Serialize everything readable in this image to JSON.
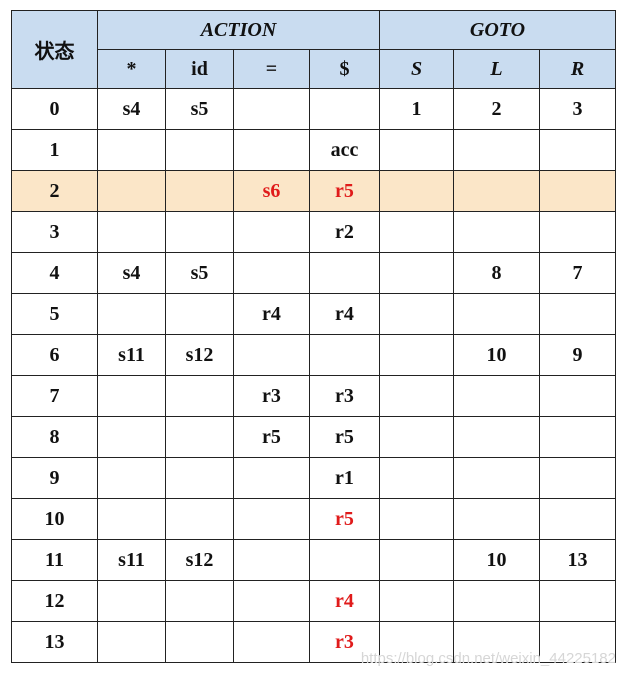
{
  "headers": {
    "state": "状态",
    "action": "ACTION",
    "goto": "GOTO",
    "action_cols": [
      "*",
      "id",
      "=",
      "$"
    ],
    "goto_cols": [
      "S",
      "L",
      "R"
    ]
  },
  "colors": {
    "header_bg": "#c9dcf0",
    "highlight_row_bg": "#fbe6c8",
    "red_text": "#e01b1b"
  },
  "rows": [
    {
      "state": "0",
      "cells": [
        "s4",
        "s5",
        "",
        "",
        "1",
        "2",
        "3"
      ]
    },
    {
      "state": "1",
      "cells": [
        "",
        "",
        "",
        "acc",
        "",
        "",
        ""
      ]
    },
    {
      "state": "2",
      "cells": [
        "",
        "",
        "s6",
        "r5",
        "",
        "",
        ""
      ],
      "highlight": true,
      "red": [
        2,
        3
      ]
    },
    {
      "state": "3",
      "cells": [
        "",
        "",
        "",
        "r2",
        "",
        "",
        ""
      ]
    },
    {
      "state": "4",
      "cells": [
        "s4",
        "s5",
        "",
        "",
        "",
        "8",
        "7"
      ]
    },
    {
      "state": "5",
      "cells": [
        "",
        "",
        "r4",
        "r4",
        "",
        "",
        ""
      ]
    },
    {
      "state": "6",
      "cells": [
        "s11",
        "s12",
        "",
        "",
        "",
        "10",
        "9"
      ]
    },
    {
      "state": "7",
      "cells": [
        "",
        "",
        "r3",
        "r3",
        "",
        "",
        ""
      ]
    },
    {
      "state": "8",
      "cells": [
        "",
        "",
        "r5",
        "r5",
        "",
        "",
        ""
      ]
    },
    {
      "state": "9",
      "cells": [
        "",
        "",
        "",
        "r1",
        "",
        "",
        ""
      ]
    },
    {
      "state": "10",
      "cells": [
        "",
        "",
        "",
        "r5",
        "",
        "",
        ""
      ],
      "red": [
        3
      ]
    },
    {
      "state": "11",
      "cells": [
        "s11",
        "s12",
        "",
        "",
        "",
        "10",
        "13"
      ]
    },
    {
      "state": "12",
      "cells": [
        "",
        "",
        "",
        "r4",
        "",
        "",
        ""
      ],
      "red": [
        3
      ]
    },
    {
      "state": "13",
      "cells": [
        "",
        "",
        "",
        "r3",
        "",
        "",
        ""
      ],
      "red": [
        3
      ]
    }
  ],
  "watermark": "https://blog.csdn.net/weixin_44225182"
}
